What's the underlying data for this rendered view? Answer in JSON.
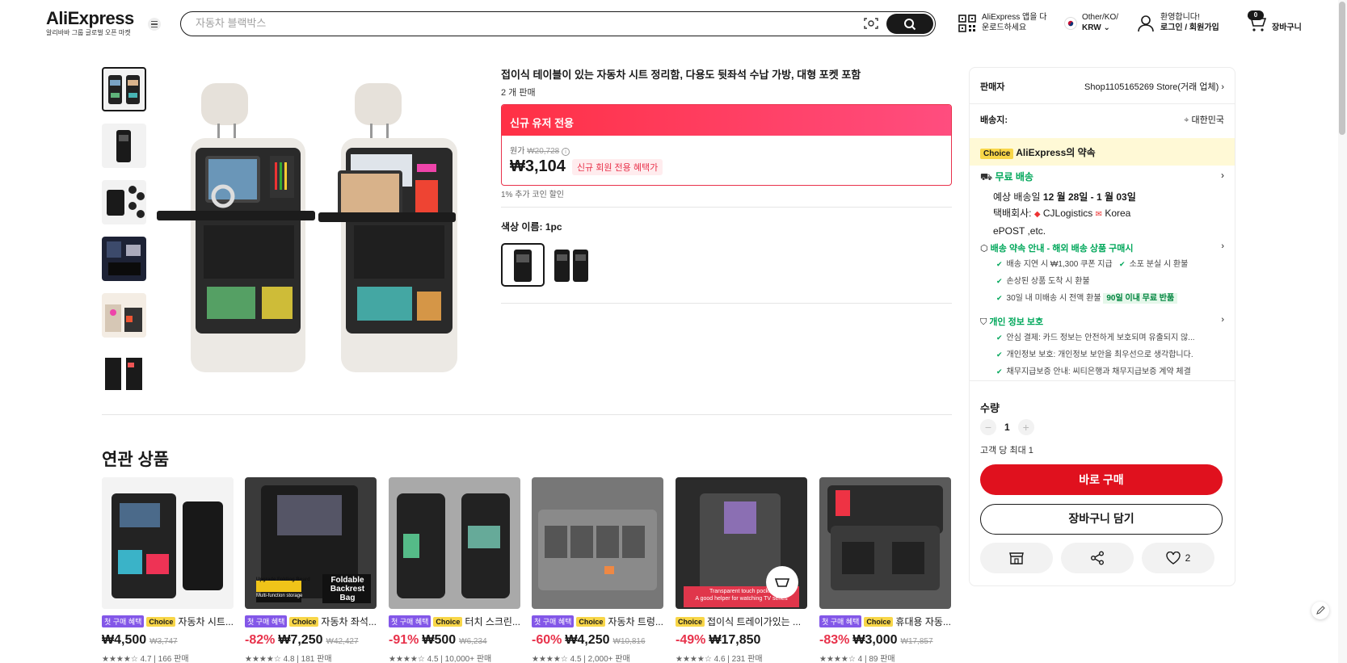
{
  "header": {
    "logo": "AliExpress",
    "logo_sub": "알리바바 그룹 글로벌 오픈 마켓",
    "search_placeholder": "자동차 블랙박스",
    "app_line1": "AliExpress 앱을 다",
    "app_line2": "운로드하세요",
    "locale_line1": "Other/KO/",
    "locale_line2": "KRW",
    "welcome_line1": "환영합니다!",
    "welcome_line2": "로그인 / 회원가입",
    "cart_count": "0",
    "cart_label": "장바구니"
  },
  "product": {
    "title": "접이식 테이블이 있는 자동차 시트 정리함, 다용도 뒷좌석 수납 가방, 대형 포켓 포함",
    "sold": "2 개 판매",
    "promo_header": "신규 유저 전용",
    "orig_label": "원가",
    "orig_price": "₩20,728",
    "price": "₩3,104",
    "price_badge": "신규 회원 전용 혜택가",
    "coin_note": "1% 추가 코인 할인",
    "color_label": "색상 이름: 1pc"
  },
  "sidebar": {
    "seller_label": "판매자",
    "seller_name": "Shop1105165269 Store(거래 업체)",
    "ship_to_label": "배송지:",
    "ship_to": "대한민국",
    "choice_tag": "Choice",
    "choice_text": "AliExpress의 약속",
    "free_ship": "무료 배송",
    "eta_label": "예상 배송일",
    "eta": "12 월 28일 - 1 월 03일",
    "carrier_label": "택배회사:",
    "carrier_1": "CJLogistics",
    "carrier_2": "Korea",
    "carrier_3": "ePOST ,etc.",
    "promise_title": "배송 약속 안내 - 해외 배송 상품 구매시",
    "promise_1": "배송 지연 시 ₩1,300 쿠폰 지급",
    "promise_2": "소포 분실 시 환불",
    "promise_3": "손상된 상품 도착 시 환불",
    "promise_4": "30일 내 미배송 시 전액 환불",
    "promise_4_badge": "90일 이내 무료 반품",
    "privacy_title": "개인 정보 보호",
    "privacy_1": "안심 결제: 카드 정보는 안전하게 보호되며 유출되지 않...",
    "privacy_2": "개인정보 보호: 개인정보 보안을 최우선으로 생각합니다.",
    "privacy_3": "채무지급보증 안내: 씨티은행과 채무지급보증 계약 체결",
    "qty_label": "수량",
    "qty_value": "1",
    "qty_minus": "−",
    "qty_plus": "+",
    "max_note": "고객 당 최대 1",
    "buy_now": "바로 구매",
    "add_cart": "장바구니 담기",
    "like_count": "2"
  },
  "related": {
    "title": "연관 상품",
    "items": [
      {
        "tag_first": "첫 구매 혜택",
        "tag_choice": "Choice",
        "name": "자동차 시트...",
        "disc": "",
        "price": "₩4,500",
        "orig": "₩3,747",
        "rating": "★★★★☆ 4.7 | 166 판매"
      },
      {
        "tag_first": "첫 구매 혜택",
        "tag_choice": "Choice",
        "name": "자동차 좌석...",
        "disc": "-82%",
        "price": "₩7,250",
        "orig": "₩42,427",
        "rating": "★★★★☆ 4.8 | 181 판매"
      },
      {
        "tag_first": "첫 구매 혜택",
        "tag_choice": "Choice",
        "name": "터치 스크린...",
        "disc": "-91%",
        "price": "₩500",
        "orig": "₩6,234",
        "rating": "★★★★☆ 4.5 | 10,000+ 판매"
      },
      {
        "tag_first": "첫 구매 혜택",
        "tag_choice": "Choice",
        "name": "자동차 트렁...",
        "disc": "-60%",
        "price": "₩4,250",
        "orig": "₩10,816",
        "rating": "★★★★☆ 4.5 | 2,000+ 판매"
      },
      {
        "tag_first": "",
        "tag_choice": "Choice",
        "name": "접이식 트레이가있는 ...",
        "disc": "-49%",
        "price": "₩17,850",
        "orig": "",
        "rating": "★★★★☆ 4.6 | 231 판매"
      },
      {
        "tag_first": "첫 구매 혜택",
        "tag_choice": "Choice",
        "name": "휴대용 자동...",
        "disc": "-83%",
        "price": "₩3,000",
        "orig": "₩17,857",
        "rating": "★★★★☆ 4 | 89 판매"
      }
    ],
    "card5_overlay_line1": "Transparent touch pocket",
    "card5_overlay_line2": "A good helper for watching TV series",
    "card2_overlay_1": "Upgrade Folding Board",
    "card2_overlay_2": "Multi-function storage",
    "card2_overlay_3": "Foldable",
    "card2_overlay_4": "Backrest",
    "card2_overlay_5": "Bag"
  },
  "colors": {
    "accent": "#e0111e",
    "promo": "#ff3045",
    "choice": "#f8d648",
    "green": "#00a75a"
  }
}
